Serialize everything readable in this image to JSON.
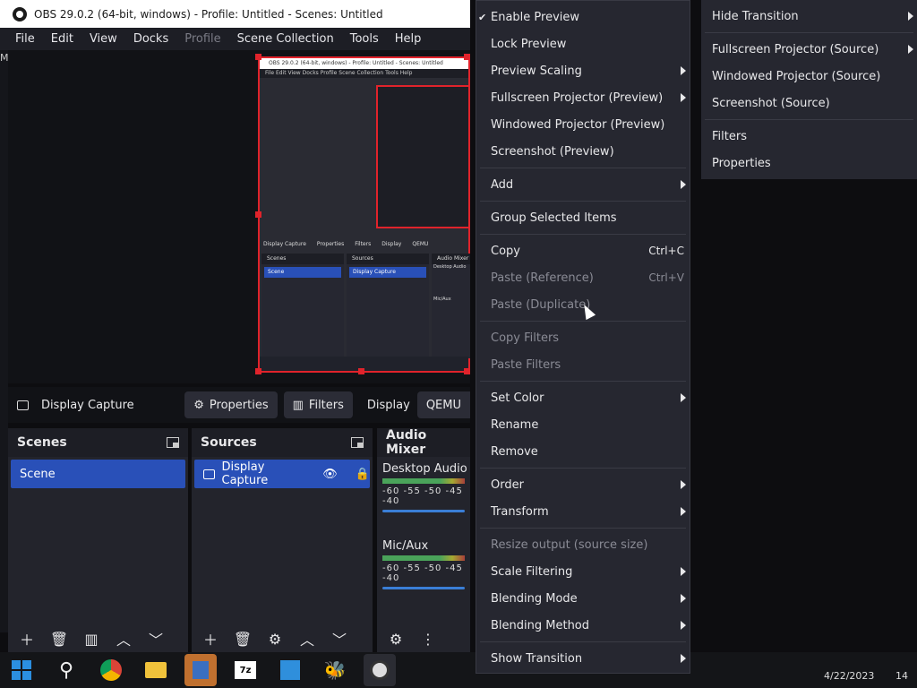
{
  "window": {
    "title": "OBS 29.0.2 (64-bit, windows) - Profile: Untitled - Scenes: Untitled"
  },
  "menubar": [
    "File",
    "Edit",
    "View",
    "Docks",
    "Profile",
    "Scene Collection",
    "Tools",
    "Help"
  ],
  "side_letter": "M",
  "mini_preview": {
    "title": "OBS 29.0.2 (64-bit, windows) - Profile: Untitled - Scenes: Untitled",
    "menus": "File  Edit  View  Docks  Profile  Scene Collection  Tools  Help",
    "context_label": "Display Capture",
    "properties": "Properties",
    "filters": "Filters",
    "display": "Display",
    "qemu": "QEMU",
    "scenes": "Scenes",
    "scene_item": "Scene",
    "sources": "Sources",
    "source_item": "Display Capture",
    "audio": "Audio Mixer",
    "desktop_audio": "Desktop Audio",
    "mic": "Mic/Aux"
  },
  "context_bar": {
    "source_name": "Display Capture",
    "properties_label": "Properties",
    "filters_label": "Filters",
    "display_label": "Display",
    "display_value": "QEMU"
  },
  "scenes_dock": {
    "title": "Scenes",
    "items": [
      "Scene"
    ]
  },
  "sources_dock": {
    "title": "Sources",
    "items": [
      "Display Capture"
    ]
  },
  "audio_dock": {
    "title": "Audio Mixer",
    "channels": [
      {
        "name": "Desktop Audio",
        "scale": "-60 -55 -50 -45 -40"
      },
      {
        "name": "Mic/Aux",
        "scale": "-60 -55 -50 -45 -40"
      }
    ]
  },
  "context_menu": {
    "items": [
      {
        "label": "Enable Preview",
        "checked": true
      },
      {
        "label": "Lock Preview"
      },
      {
        "label": "Preview Scaling",
        "submenu": true
      },
      {
        "label": "Fullscreen Projector (Preview)",
        "submenu": true
      },
      {
        "label": "Windowed Projector (Preview)"
      },
      {
        "label": "Screenshot (Preview)"
      },
      {
        "label": "Add",
        "submenu": true
      },
      {
        "label": "Group Selected Items"
      },
      {
        "label": "Copy",
        "shortcut": "Ctrl+C"
      },
      {
        "label": "Paste (Reference)",
        "shortcut": "Ctrl+V",
        "disabled": true
      },
      {
        "label": "Paste (Duplicate)",
        "disabled": true
      },
      {
        "label": "Copy Filters",
        "disabled": true
      },
      {
        "label": "Paste Filters",
        "disabled": true
      },
      {
        "label": "Set Color",
        "submenu": true
      },
      {
        "label": "Rename"
      },
      {
        "label": "Remove"
      },
      {
        "label": "Order",
        "submenu": true
      },
      {
        "label": "Transform",
        "submenu": true
      },
      {
        "label": "Resize output (source size)",
        "disabled": true
      },
      {
        "label": "Scale Filtering",
        "submenu": true
      },
      {
        "label": "Blending Mode",
        "submenu": true
      },
      {
        "label": "Blending Method",
        "submenu": true
      },
      {
        "label": "Show Transition",
        "submenu": true
      }
    ]
  },
  "submenu": {
    "items": [
      {
        "label": "Hide Transition",
        "submenu": true
      },
      {
        "label": "Fullscreen Projector (Source)",
        "submenu": true
      },
      {
        "label": "Windowed Projector (Source)"
      },
      {
        "label": "Screenshot (Source)"
      },
      {
        "label": "Filters"
      },
      {
        "label": "Properties"
      }
    ]
  },
  "tray": {
    "date": "4/22/2023",
    "badge": "14"
  },
  "colors": {
    "accent": "#2950b8",
    "selection_border": "#e0232b",
    "menu_bg": "#262730"
  }
}
